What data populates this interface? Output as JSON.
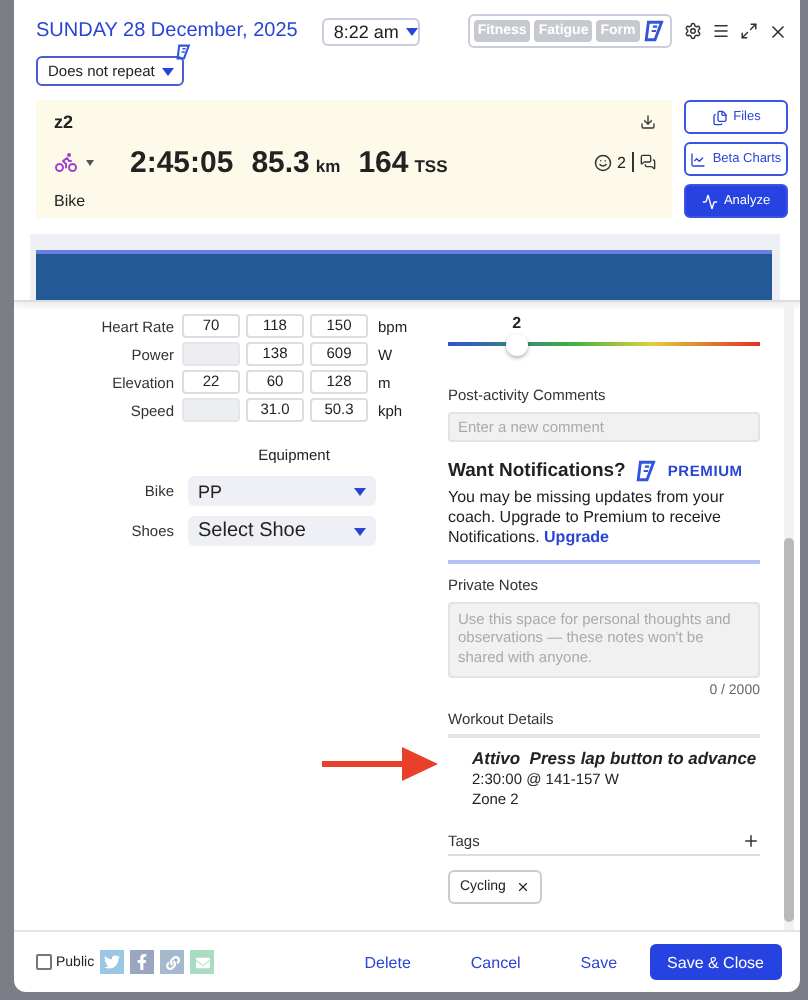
{
  "header": {
    "date": "SUNDAY 28 December, 2025",
    "time": "8:22 am",
    "toggles": [
      {
        "label": "Fitness",
        "selected": false
      },
      {
        "label": "Fatigue",
        "selected": false
      },
      {
        "label": "Form",
        "selected": false
      }
    ],
    "repeat": "Does not repeat"
  },
  "summary": {
    "title": "z2",
    "sport": "Bike",
    "duration": "2:45:05",
    "distance": "85.3",
    "distance_unit": "km",
    "tss": "164",
    "tss_unit": "TSS",
    "feel_count": "2"
  },
  "side_buttons": [
    {
      "label": "Files",
      "selected": false
    },
    {
      "label": "Beta Charts",
      "selected": false
    },
    {
      "label": "Analyze",
      "selected": true
    }
  ],
  "metrics": [
    {
      "label": "Heart Rate",
      "min": "70",
      "avg": "118",
      "max": "150",
      "unit": "bpm"
    },
    {
      "label": "Power",
      "avg": "138",
      "max": "609",
      "unit": "W"
    },
    {
      "label": "Elevation",
      "min": "22",
      "avg": "60",
      "max": "128",
      "unit": "m"
    },
    {
      "label": "Speed",
      "avg": "31.0",
      "max": "50.3",
      "unit": "kph"
    }
  ],
  "equipment": {
    "title": "Equipment",
    "fields": [
      {
        "label": "Bike",
        "value": "PP"
      },
      {
        "label": "Shoes",
        "value": "Select Shoe"
      }
    ]
  },
  "rpe": {
    "value": "2",
    "level": 0.22
  },
  "comments": {
    "label": "Post-activity Comments",
    "placeholder": "Enter a new comment"
  },
  "notifications": {
    "title": "Want Notifications?",
    "badge": "PREMIUM",
    "text": "You may be missing updates from your coach. Upgrade to Premium to receive Notifications.",
    "link": "Upgrade"
  },
  "private_notes": {
    "label": "Private Notes",
    "placeholder": "Use this space for personal thoughts and observations — these notes won't be shared with anyone.",
    "counter": "0 / 2000"
  },
  "workout_details": {
    "label": "Workout Details",
    "title": "Attivo  Press lap button to advance",
    "lines": [
      "2:30:00 @ 141-157 W",
      "Zone 2"
    ]
  },
  "tags": {
    "label": "Tags",
    "items": [
      "Cycling"
    ]
  },
  "footer": {
    "public_label": "Public",
    "public_checked": false,
    "actions": [
      "Delete",
      "Cancel",
      "Save"
    ],
    "primary": "Save & Close"
  }
}
